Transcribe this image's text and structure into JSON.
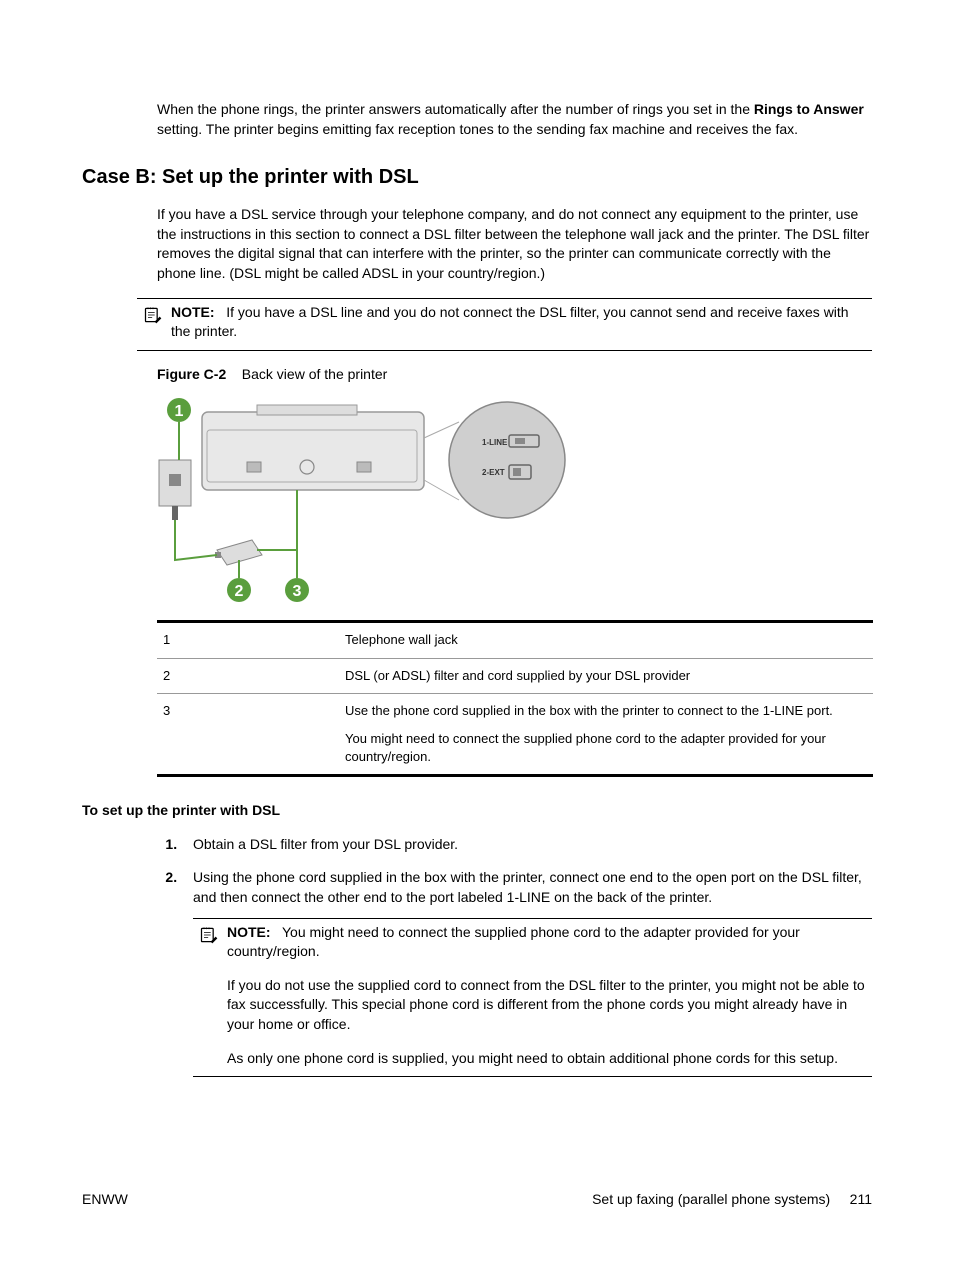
{
  "intro": {
    "part1": "When the phone rings, the printer answers automatically after the number of rings you set in the ",
    "bold": "Rings to Answer",
    "part2": " setting. The printer begins emitting fax reception tones to the sending fax machine and receives the fax."
  },
  "heading": "Case B: Set up the printer with DSL",
  "body1": "If you have a DSL service through your telephone company, and do not connect any equipment to the printer, use the instructions in this section to connect a DSL filter between the telephone wall jack and the printer. The DSL filter removes the digital signal that can interfere with the printer, so the printer can communicate correctly with the phone line. (DSL might be called ADSL in your country/region.)",
  "note1": {
    "label": "NOTE:",
    "text": "If you have a DSL line and you do not connect the DSL filter, you cannot send and receive faxes with the printer."
  },
  "figure": {
    "label": "Figure C-2",
    "caption": "Back view of the printer",
    "label_1line": "1-LINE",
    "label_2ext": "2-EXT"
  },
  "callouts": [
    {
      "num": "1",
      "desc": "Telephone wall jack"
    },
    {
      "num": "2",
      "desc": "DSL (or ADSL) filter and cord supplied by your DSL provider"
    },
    {
      "num": "3",
      "desc": "Use the phone cord supplied in the box with the printer to connect to the 1-LINE port.",
      "extra": "You might need to connect the supplied phone cord to the adapter provided for your country/region."
    }
  ],
  "subheading": "To set up the printer with DSL",
  "steps": {
    "s1": "Obtain a DSL filter from your DSL provider.",
    "s2": "Using the phone cord supplied in the box with the printer, connect one end to the open port on the DSL filter, and then connect the other end to the port labeled 1-LINE on the back of the printer.",
    "s2_note_label": "NOTE:",
    "s2_note": "You might need to connect the supplied phone cord to the adapter provided for your country/region.",
    "s2_p2": "If you do not use the supplied cord to connect from the DSL filter to the printer, you might not be able to fax successfully. This special phone cord is different from the phone cords you might already have in your home or office.",
    "s2_p3": "As only one phone cord is supplied, you might need to obtain additional phone cords for this setup."
  },
  "footer": {
    "left": "ENWW",
    "right_text": "Set up faxing (parallel phone systems)",
    "page": "211"
  }
}
